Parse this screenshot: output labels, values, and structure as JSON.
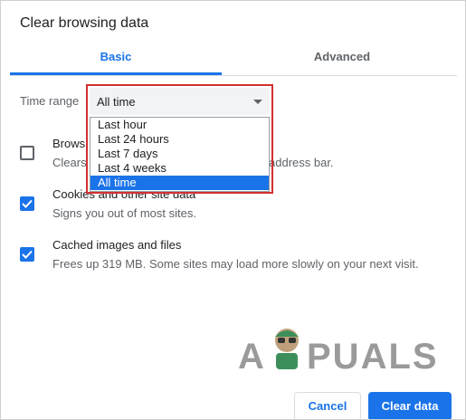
{
  "dialog": {
    "title": "Clear browsing data",
    "tabs": [
      {
        "label": "Basic",
        "active": true
      },
      {
        "label": "Advanced",
        "active": false
      }
    ]
  },
  "time_range": {
    "label": "Time range",
    "selected": "All time",
    "options": [
      "Last hour",
      "Last 24 hours",
      "Last 7 days",
      "Last 4 weeks",
      "All time"
    ]
  },
  "items": [
    {
      "title_visible": "Browsi",
      "desc_left": "Clears",
      "desc_right": "address bar.",
      "checked": false
    },
    {
      "title": "Cookies and other site data",
      "desc": "Signs you out of most sites.",
      "checked": true
    },
    {
      "title": "Cached images and files",
      "desc": "Frees up 319 MB. Some sites may load more slowly on your next visit.",
      "checked": true
    }
  ],
  "watermark": {
    "left": "A",
    "right": "PUALS"
  },
  "buttons": {
    "cancel": "Cancel",
    "clear": "Clear data"
  },
  "colors": {
    "accent": "#1a73e8",
    "highlight_frame": "#d32f2f"
  }
}
